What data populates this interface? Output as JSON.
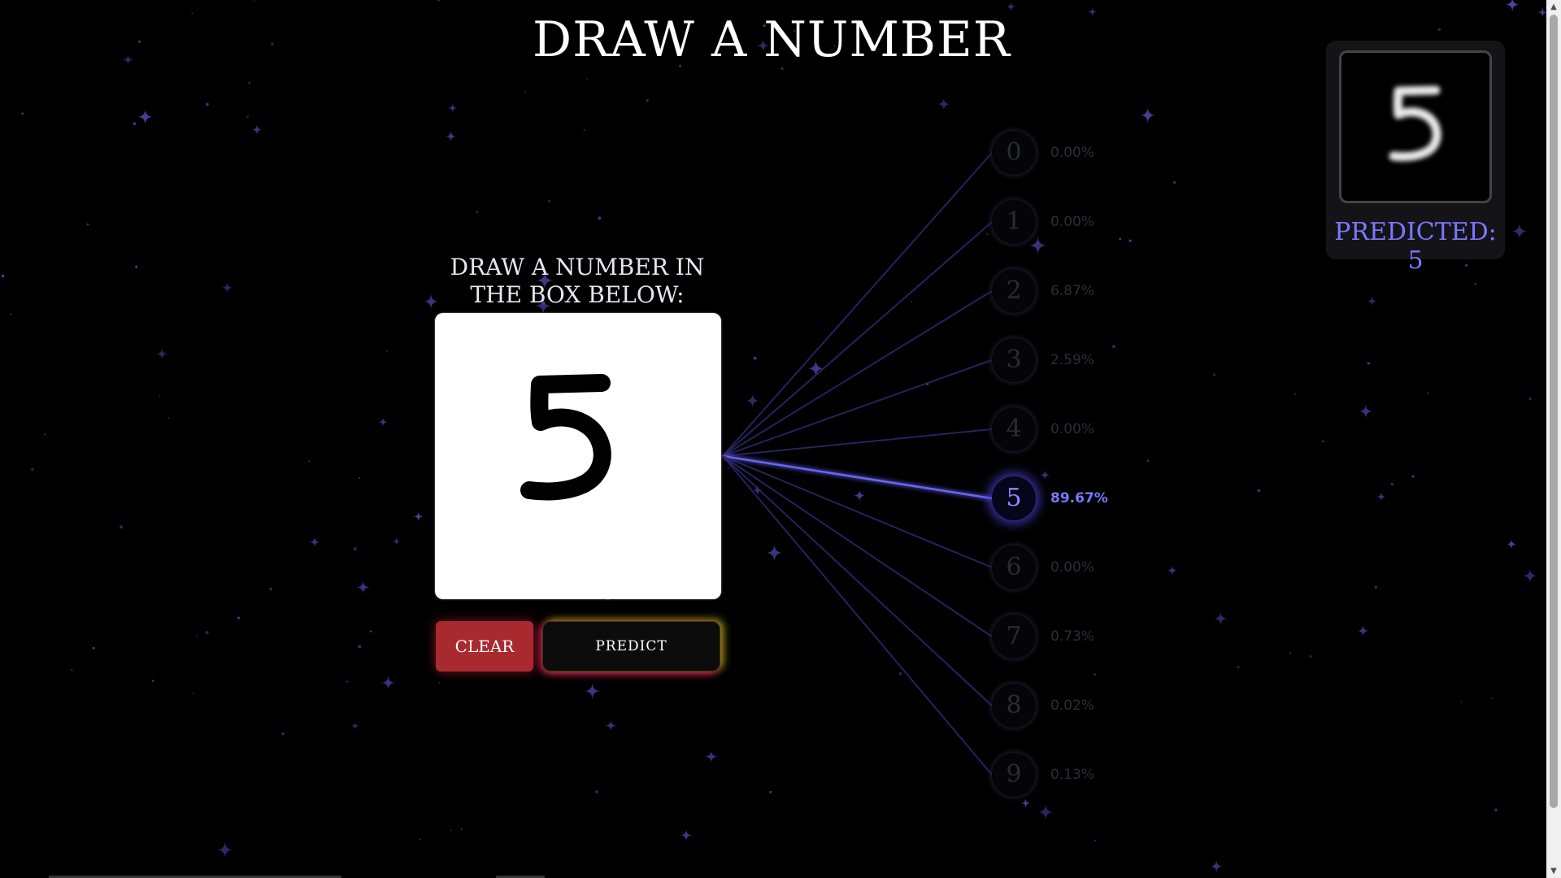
{
  "page": {
    "title": "DRAW A NUMBER",
    "instructions": "DRAW A NUMBER IN THE BOX BELOW:"
  },
  "canvas": {
    "drawn_digit": "5"
  },
  "buttons": {
    "clear_label": "CLEAR",
    "predict_label": "PREDICT"
  },
  "network": {
    "outputs": [
      {
        "digit": "0",
        "probability": "0.00%"
      },
      {
        "digit": "1",
        "probability": "0.00%"
      },
      {
        "digit": "2",
        "probability": "6.87%"
      },
      {
        "digit": "3",
        "probability": "2.59%"
      },
      {
        "digit": "4",
        "probability": "0.00%"
      },
      {
        "digit": "5",
        "probability": "89.67%"
      },
      {
        "digit": "6",
        "probability": "0.00%"
      },
      {
        "digit": "7",
        "probability": "0.73%"
      },
      {
        "digit": "8",
        "probability": "0.02%"
      },
      {
        "digit": "9",
        "probability": "0.13%"
      }
    ],
    "predicted_index": 5
  },
  "prediction": {
    "preview_digit": "5",
    "label": "PREDICTED: 5"
  },
  "colors": {
    "background": "#000000",
    "accent": "#7b78ff",
    "clear_button": "#a82a2e",
    "star": "#4a46a8"
  },
  "icons": {
    "scroll_up": "triangle-up-icon",
    "scroll_down": "triangle-down-icon"
  }
}
